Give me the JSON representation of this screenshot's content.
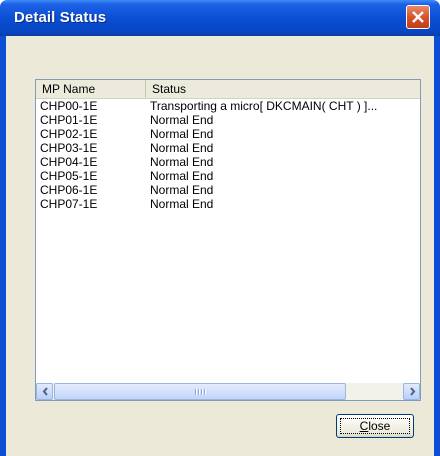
{
  "window": {
    "title": "Detail Status",
    "close_icon": "close-icon"
  },
  "table": {
    "columns": [
      "MP Name",
      "Status"
    ],
    "rows": [
      {
        "name": "CHP00-1E",
        "status": "Transporting a micro[ DKCMAIN( CHT ) ]..."
      },
      {
        "name": "CHP01-1E",
        "status": "Normal End"
      },
      {
        "name": "CHP02-1E",
        "status": "Normal End"
      },
      {
        "name": "CHP03-1E",
        "status": "Normal End"
      },
      {
        "name": "CHP04-1E",
        "status": "Normal End"
      },
      {
        "name": "CHP05-1E",
        "status": "Normal End"
      },
      {
        "name": "CHP06-1E",
        "status": "Normal End"
      },
      {
        "name": "CHP07-1E",
        "status": "Normal End"
      }
    ]
  },
  "buttons": {
    "close_label": "Close"
  },
  "colors": {
    "titlebar": "#0a4fd4",
    "close_button": "#d5512a",
    "client_bg": "#ece9d8"
  }
}
